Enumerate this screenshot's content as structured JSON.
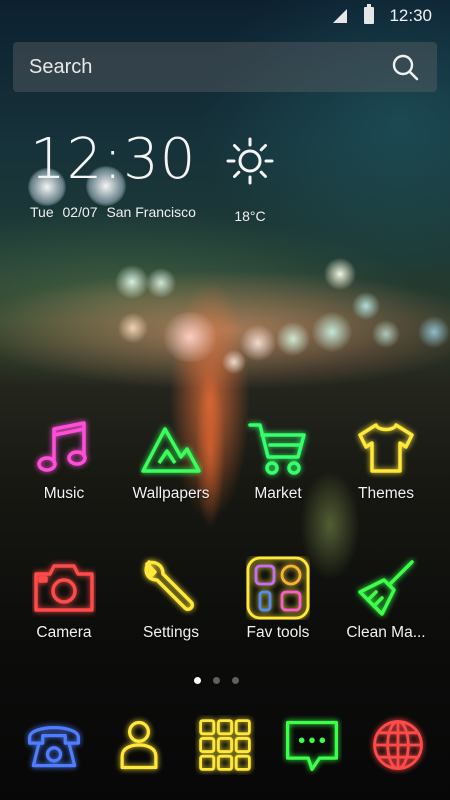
{
  "status_bar": {
    "time": "12:30"
  },
  "search": {
    "placeholder": "Search"
  },
  "clock_widget": {
    "time": "12:30",
    "day": "Tue",
    "date": "02/07",
    "city": "San Francisco",
    "temperature": "18°C",
    "weather_icon": "sun-icon"
  },
  "apps_row1": [
    {
      "label": "Music",
      "icon": "music-note-icon",
      "color": "#ff4fd8"
    },
    {
      "label": "Wallpapers",
      "icon": "mountain-icon",
      "color": "#39ff5a"
    },
    {
      "label": "Market",
      "icon": "cart-icon",
      "color": "#35ff6a"
    },
    {
      "label": "Themes",
      "icon": "tshirt-icon",
      "color": "#ffe83a"
    }
  ],
  "apps_row2": [
    {
      "label": "Camera",
      "icon": "camera-icon",
      "color": "#ff4a4a"
    },
    {
      "label": "Settings",
      "icon": "wrench-icon",
      "color": "#ffe83a"
    },
    {
      "label": "Fav tools",
      "icon": "folder-icon",
      "color": "#ffe83a"
    },
    {
      "label": "Clean Ma...",
      "icon": "broom-icon",
      "color": "#3cff4a"
    }
  ],
  "page_indicator": {
    "pages": 3,
    "active": 1
  },
  "dock": [
    {
      "icon": "phone-icon",
      "color": "#4f7dff"
    },
    {
      "icon": "contacts-icon",
      "color": "#ffe83a"
    },
    {
      "icon": "app-drawer-icon",
      "color": "#ffe83a"
    },
    {
      "icon": "messages-icon",
      "color": "#3cff4a"
    },
    {
      "icon": "browser-icon",
      "color": "#ff4a4a"
    }
  ]
}
